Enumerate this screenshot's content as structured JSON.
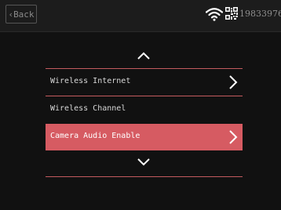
{
  "header": {
    "back_label": "Back",
    "device_id": "1983397686"
  },
  "icons": {
    "back": "chevron-left-icon",
    "wifi": "wifi-icon",
    "qr": "qr-code-icon",
    "scroll_up": "chevron-up-icon",
    "scroll_down": "chevron-down-icon",
    "item_arrow": "chevron-right-icon"
  },
  "colors": {
    "background": "#111111",
    "topbar": "#1c1c1c",
    "accent": "#d65b62",
    "divider": "#c45b5f",
    "text": "#d8d8d8"
  },
  "menu": {
    "items": [
      {
        "label": "Wireless Internet",
        "has_arrow": true,
        "selected": false
      },
      {
        "label": "Wireless Channel",
        "has_arrow": false,
        "selected": false
      },
      {
        "label": "Camera Audio Enable",
        "has_arrow": true,
        "selected": true
      }
    ]
  }
}
